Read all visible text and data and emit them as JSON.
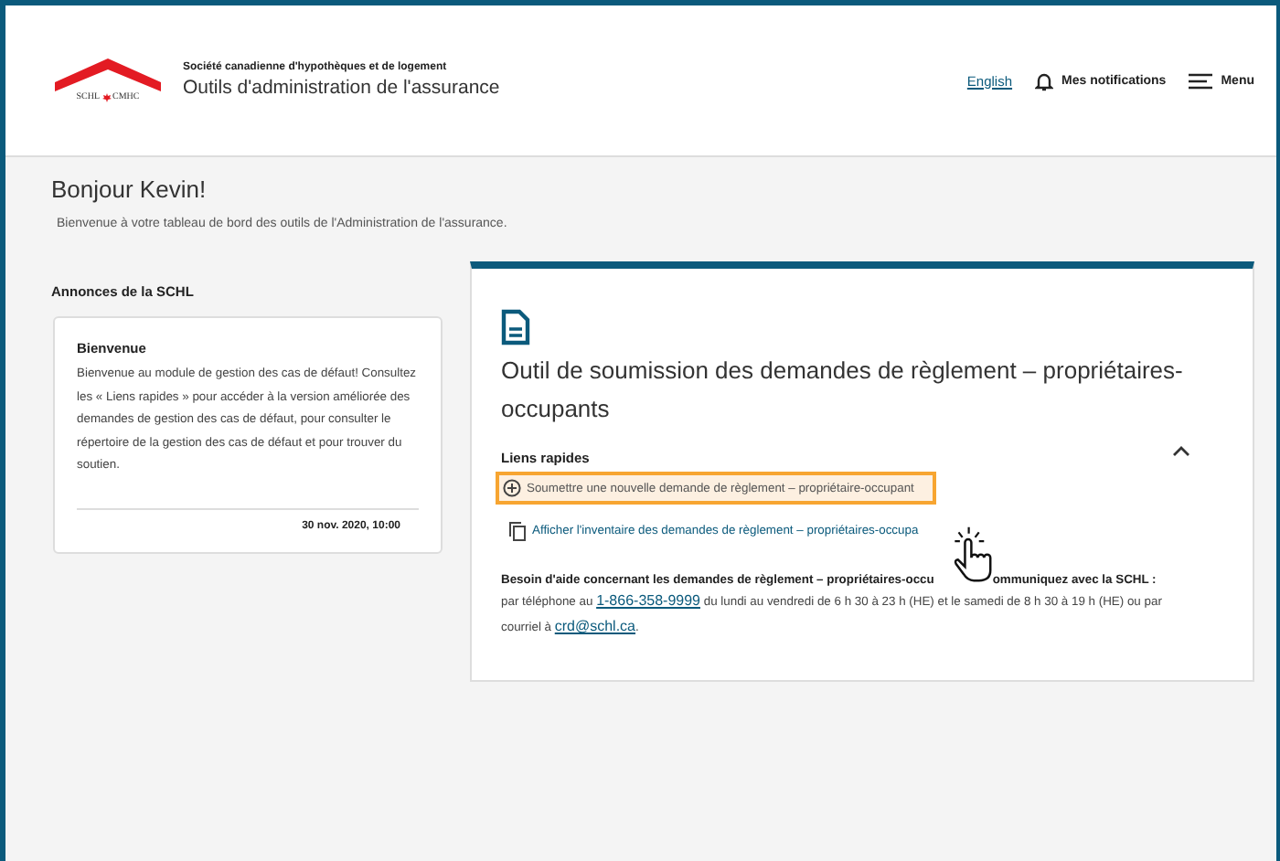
{
  "header": {
    "logo_text": [
      "SCHL",
      "CMHC"
    ],
    "organization": "Société canadienne d'hypothèques et de logement",
    "app_title": "Outils d'administration de l'assurance",
    "language_link": "English",
    "notifications": "Mes notifications",
    "menu": "Menu"
  },
  "greeting": {
    "title": "Bonjour Kevin!",
    "subtitle": "Bienvenue à votre tableau de bord des outils de l'Administration de l'assurance."
  },
  "announcements": {
    "heading": "Annonces de la SCHL",
    "items": [
      {
        "title": "Bienvenue",
        "body": "Bienvenue au module de gestion des cas de défaut! Consultez les « Liens rapides » pour accéder à la version améliorée des demandes de gestion des cas de défaut, pour consulter le répertoire de la gestion des cas de défaut et pour trouver du soutien.",
        "date": "30 nov. 2020, 10:00"
      }
    ]
  },
  "tool_card": {
    "title": "Outil de soumission des demandes de règlement – propriétaires-occupants",
    "expanded": true,
    "quick_links_heading": "Liens rapides",
    "links": [
      {
        "kind": "add",
        "label": "Soumettre une nouvelle demande de règlement – propriétaire-occupant",
        "selected": true
      },
      {
        "kind": "copy",
        "label": "Afficher l'inventaire des demandes de règlement – propriétaires-occupa",
        "selected": false
      }
    ],
    "help_heading_parts": [
      "Besoin d'aide concernant les demandes de règlement – propriétaires-occu",
      "ommuniquez avec la SCHL :"
    ],
    "help_text_before_phone": "par téléphone au",
    "phone": "1-866-358-9999",
    "help_text_after_phone": "du lundi au vendredi de 6 h 30 à 23 h (HE) et le samedi de 8 h 30 à 19 h (HE) ou par courriel à",
    "email": "crd@schl.ca",
    "help_text_end": "."
  }
}
